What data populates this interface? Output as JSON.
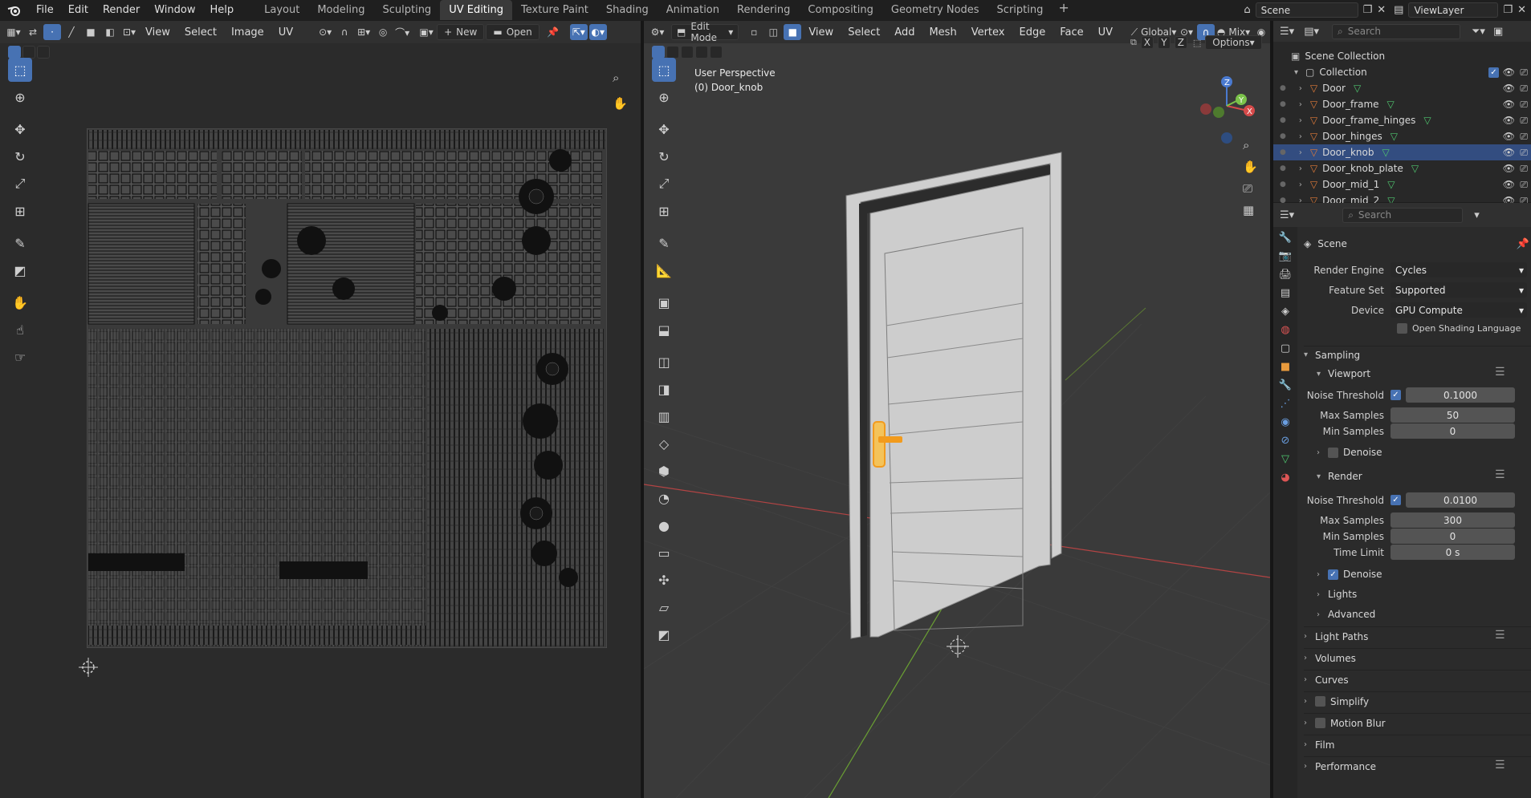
{
  "topbar": {
    "menus": [
      "File",
      "Edit",
      "Render",
      "Window",
      "Help"
    ],
    "workspaces": [
      "Layout",
      "Modeling",
      "Sculpting",
      "UV Editing",
      "Texture Paint",
      "Shading",
      "Animation",
      "Rendering",
      "Compositing",
      "Geometry Nodes",
      "Scripting"
    ],
    "active_workspace": "UV Editing",
    "scene": "Scene",
    "view_layer": "ViewLayer"
  },
  "uv_editor": {
    "menus": [
      "View",
      "Select",
      "Image",
      "UV"
    ],
    "new_label": "New",
    "open_label": "Open"
  },
  "viewport": {
    "mode": "Edit Mode",
    "menus": [
      "View",
      "Select",
      "Add",
      "Mesh",
      "Vertex",
      "Edge",
      "Face",
      "UV"
    ],
    "orientation": "Global",
    "shading": "Mix",
    "options_label": "Options",
    "overlay_title": "User Perspective",
    "overlay_object": "(0) Door_knob",
    "axes": [
      "X",
      "Y",
      "Z"
    ]
  },
  "outliner": {
    "search_placeholder": "Search",
    "scene_collection": "Scene Collection",
    "collection": "Collection",
    "items": [
      {
        "name": "Door",
        "selected": false
      },
      {
        "name": "Door_frame",
        "selected": false
      },
      {
        "name": "Door_frame_hinges",
        "selected": false
      },
      {
        "name": "Door_hinges",
        "selected": false
      },
      {
        "name": "Door_knob",
        "selected": true
      },
      {
        "name": "Door_knob_plate",
        "selected": false
      },
      {
        "name": "Door_mid_1",
        "selected": false
      },
      {
        "name": "Door_mid_2",
        "selected": false
      }
    ]
  },
  "properties": {
    "search_placeholder": "Search",
    "context": "Scene",
    "render_engine_label": "Render Engine",
    "render_engine": "Cycles",
    "feature_set_label": "Feature Set",
    "feature_set": "Supported",
    "device_label": "Device",
    "device": "GPU Compute",
    "osl_label": "Open Shading Language",
    "sampling": "Sampling",
    "viewport": "Viewport",
    "noise_threshold_label": "Noise Threshold",
    "vp_noise_threshold": "0.1000",
    "max_samples_label": "Max Samples",
    "vp_max_samples": "50",
    "min_samples_label": "Min Samples",
    "vp_min_samples": "0",
    "denoise": "Denoise",
    "render": "Render",
    "r_noise_threshold": "0.0100",
    "r_max_samples": "300",
    "r_min_samples": "0",
    "time_limit_label": "Time Limit",
    "time_limit": "0 s",
    "lights": "Lights",
    "advanced": "Advanced",
    "light_paths": "Light Paths",
    "volumes": "Volumes",
    "curves": "Curves",
    "simplify": "Simplify",
    "motion_blur": "Motion Blur",
    "film": "Film",
    "performance": "Performance"
  },
  "colors": {
    "accent": "#4772b3",
    "selected_obj": "#f29b1d",
    "mesh_icon": "#e07b39",
    "data_icon": "#4fc66f"
  }
}
